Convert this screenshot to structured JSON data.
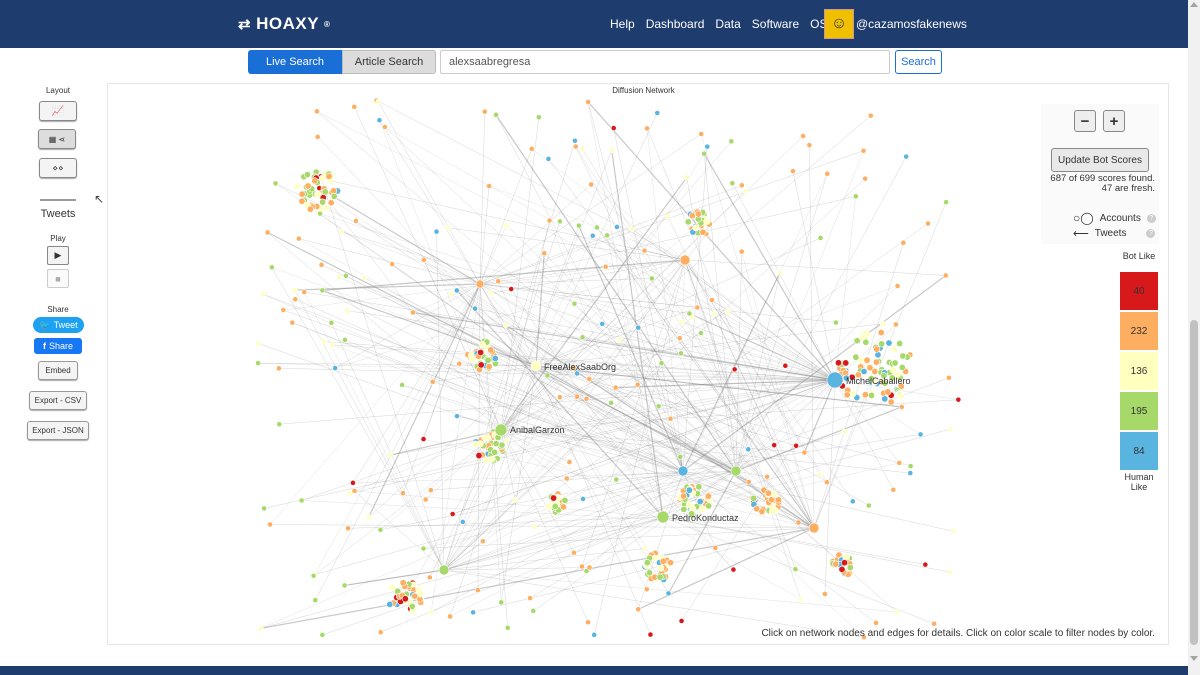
{
  "brand": {
    "name": "HOAXY",
    "mark": "®"
  },
  "nav": {
    "links": [
      "Help",
      "Dashboard",
      "Data",
      "Software",
      "OSoMe"
    ],
    "username": "@cazamosfakenews"
  },
  "search": {
    "tab_live": "Live Search",
    "tab_article": "Article Search",
    "query": "alexsaabregresa",
    "button": "Search"
  },
  "sidebar": {
    "layout_label": "Layout",
    "tweets_label": "Tweets",
    "play_label": "Play",
    "share_label": "Share",
    "tweet_button": "Tweet",
    "share_button": "Share",
    "embed_button": "Embed",
    "export_csv": "Export - CSV",
    "export_json": "Export - JSON"
  },
  "graph": {
    "title": "Diffusion Network",
    "hub_labels": [
      "FreeAlexSaabOrg",
      "MichelCaballero",
      "AnibalGarzon",
      "PedroKonductaz"
    ],
    "help": "Click on network nodes and edges for details. Click on color scale to filter nodes by color."
  },
  "controls": {
    "zoom_out": "−",
    "zoom_in": "+",
    "update_button": "Update Bot Scores",
    "scores_line1": "687 of 699 scores found.",
    "scores_line2": "47 are fresh.",
    "legend_accounts": "Accounts",
    "legend_tweets": "Tweets"
  },
  "bot_scale": {
    "top_label": "Bot Like",
    "bottom_label": "Human Like",
    "bins": [
      {
        "count": "40",
        "color": "#d7191c"
      },
      {
        "count": "232",
        "color": "#fdae61"
      },
      {
        "count": "136",
        "color": "#ffffbf"
      },
      {
        "count": "195",
        "color": "#a6d96a"
      },
      {
        "count": "84",
        "color": "#5ab4e0"
      }
    ]
  }
}
